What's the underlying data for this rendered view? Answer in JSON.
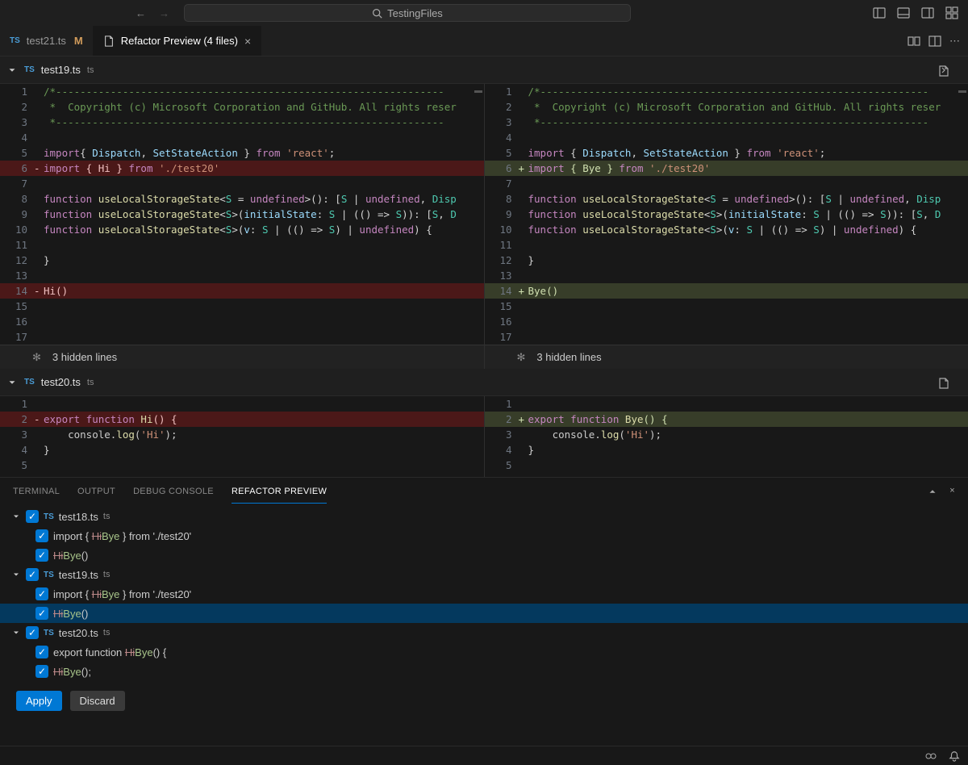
{
  "title_bar": {
    "search_text": "TestingFiles"
  },
  "tabs": {
    "tab1": {
      "label": "test21.ts",
      "badge": "M"
    },
    "tab2": {
      "label": "Refactor Preview (4 files)"
    }
  },
  "diff1": {
    "filename": "test19.ts",
    "ext": "ts",
    "hidden_lines": "3 hidden lines",
    "left": {
      "l1": "/*----------------------------------------------------------------",
      "l2": " *  Copyright (c) Microsoft Corporation and GitHub. All rights reser",
      "l3": " *----------------------------------------------------------------",
      "l5a": "import",
      "l5b": "{ ",
      "l5c": "Dispatch",
      "l5d": ", ",
      "l5e": "SetStateAction",
      "l5f": " }",
      "l5g": " from ",
      "l5h": "'react'",
      "l5i": ";",
      "l6a": "import",
      "l6b": " { ",
      "l6c": "Hi",
      "l6d": " } ",
      "l6e": "from",
      "l6f": " './test20'",
      "l8": "function useLocalStorageState<S = undefined>(): [S | undefined, Disp",
      "l9": "function useLocalStorageState<S>(initialState: S | (() => S)): [S, D",
      "l10": "function useLocalStorageState<S>(v: S | (() => S) | undefined) {",
      "l12": "}",
      "l14": "Hi()"
    },
    "right": {
      "l1": "/*----------------------------------------------------------------",
      "l2": " *  Copyright (c) Microsoft Corporation and GitHub. All rights reser",
      "l3": " *----------------------------------------------------------------",
      "l5a": "import",
      "l5b": " { ",
      "l5c": "Dispatch",
      "l5d": ", ",
      "l5e": "SetStateAction",
      "l5f": " } ",
      "l5g": "from ",
      "l5h": "'react'",
      "l5i": ";",
      "l6a": "import",
      "l6b": " { ",
      "l6c": "Bye",
      "l6d": " } ",
      "l6e": "from",
      "l6f": " './test20'",
      "l8": "function useLocalStorageState<S = undefined>(): [S | undefined, Disp",
      "l9": "function useLocalStorageState<S>(initialState: S | (() => S)): [S, D",
      "l10": "function useLocalStorageState<S>(v: S | (() => S) | undefined) {",
      "l12": "}",
      "l14": "Bye()"
    }
  },
  "diff2": {
    "filename": "test20.ts",
    "ext": "ts",
    "left": {
      "l2a": "export",
      "l2b": " function ",
      "l2c": "Hi",
      "l2d": "() {",
      "l3a": "    console.",
      "l3b": "log",
      "l3c": "(",
      "l3d": "'Hi'",
      "l3e": ");",
      "l4": "}"
    },
    "right": {
      "l2a": "export",
      "l2b": " function ",
      "l2c": "Bye",
      "l2d": "() {",
      "l3a": "    console.",
      "l3b": "log",
      "l3c": "(",
      "l3d": "'Hi'",
      "l3e": ");",
      "l4": "}"
    }
  },
  "panel": {
    "tabs": {
      "terminal": "TERMINAL",
      "output": "OUTPUT",
      "debug": "DEBUG CONSOLE",
      "refactor": "REFACTOR PREVIEW"
    },
    "tree": {
      "f1": {
        "name": "test18.ts",
        "ext": "ts"
      },
      "f1c1a": "import { ",
      "f1c1b": "Hi",
      "f1c1c": "Bye",
      "f1c1d": " } from './test20'",
      "f1c2a": "Hi",
      "f1c2b": "Bye",
      "f1c2c": "()",
      "f2": {
        "name": "test19.ts",
        "ext": "ts"
      },
      "f2c1a": "import { ",
      "f2c1b": "Hi",
      "f2c1c": "Bye",
      "f2c1d": " } from './test20'",
      "f2c2a": "Hi",
      "f2c2b": "Bye",
      "f2c2c": "()",
      "f3": {
        "name": "test20.ts",
        "ext": "ts"
      },
      "f3c1a": "export function ",
      "f3c1b": "Hi",
      "f3c1c": "Bye",
      "f3c1d": "() {",
      "f3c2a": "Hi",
      "f3c2b": "Bye",
      "f3c2c": "();"
    },
    "buttons": {
      "apply": "Apply",
      "discard": "Discard"
    }
  }
}
